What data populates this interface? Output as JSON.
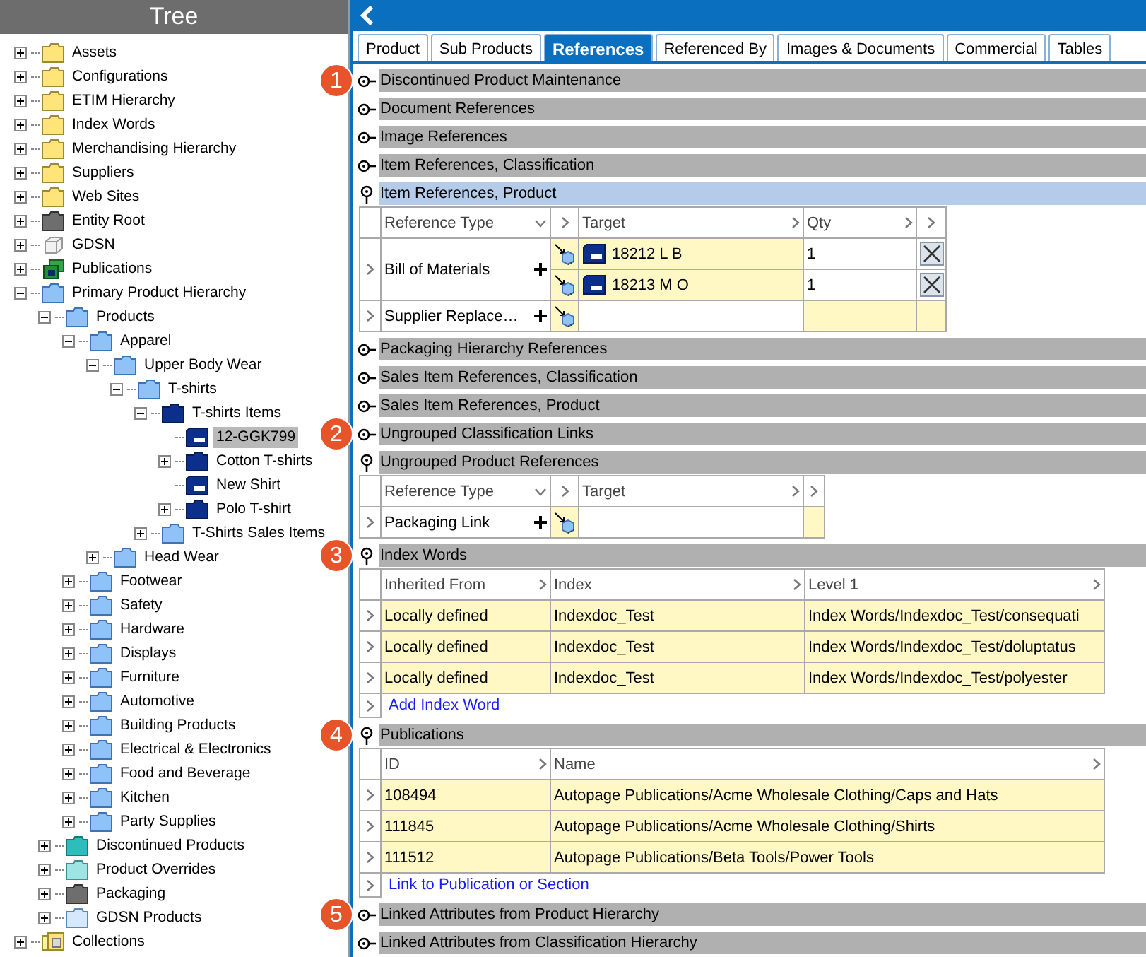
{
  "tree": {
    "title": "Tree",
    "items": [
      {
        "label": "Assets",
        "kind": "folder",
        "expanded": false,
        "selected": false
      },
      {
        "label": "Configurations",
        "kind": "folder",
        "expanded": false,
        "selected": false
      },
      {
        "label": "ETIM Hierarchy",
        "kind": "folder",
        "expanded": false,
        "selected": false
      },
      {
        "label": "Index Words",
        "kind": "folder",
        "expanded": false,
        "selected": false
      },
      {
        "label": "Merchandising Hierarchy",
        "kind": "folder",
        "expanded": false,
        "selected": false
      },
      {
        "label": "Suppliers",
        "kind": "folder",
        "expanded": false,
        "selected": false
      },
      {
        "label": "Web Sites",
        "kind": "folder",
        "expanded": false,
        "selected": false
      },
      {
        "label": "Entity Root",
        "kind": "entity-folder",
        "expanded": false,
        "selected": false
      },
      {
        "label": "GDSN",
        "kind": "cube",
        "expanded": false,
        "selected": false
      },
      {
        "label": "Publications",
        "kind": "publications",
        "expanded": false,
        "selected": false
      },
      {
        "label": "Primary Product Hierarchy",
        "kind": "category-folder",
        "expanded": true,
        "selected": false,
        "children": [
          {
            "label": "Products",
            "kind": "category-folder",
            "expanded": true,
            "selected": false,
            "children": [
              {
                "label": "Apparel",
                "kind": "category-folder",
                "expanded": true,
                "selected": false,
                "children": [
                  {
                    "label": "Upper Body Wear",
                    "kind": "category-folder",
                    "expanded": true,
                    "selected": false,
                    "children": [
                      {
                        "label": "T-shirts",
                        "kind": "category-folder",
                        "expanded": true,
                        "selected": false,
                        "children": [
                          {
                            "label": "T-shirts Items",
                            "kind": "product-folder",
                            "expanded": true,
                            "selected": false,
                            "children": [
                              {
                                "label": "12-GGK799",
                                "kind": "product",
                                "selected": true
                              },
                              {
                                "label": "Cotton T-shirts",
                                "kind": "product-folder",
                                "expanded": false,
                                "selected": false
                              },
                              {
                                "label": "New Shirt",
                                "kind": "product",
                                "selected": false
                              },
                              {
                                "label": "Polo T-shirt",
                                "kind": "product-folder",
                                "expanded": false,
                                "selected": false
                              }
                            ]
                          },
                          {
                            "label": "T-Shirts Sales Items",
                            "kind": "category-folder",
                            "expanded": false,
                            "selected": false
                          }
                        ]
                      }
                    ]
                  },
                  {
                    "label": "Head Wear",
                    "kind": "category-folder",
                    "expanded": false,
                    "selected": false
                  }
                ]
              },
              {
                "label": "Footwear",
                "kind": "category-folder",
                "expanded": false,
                "selected": false
              },
              {
                "label": "Safety",
                "kind": "category-folder",
                "expanded": false,
                "selected": false
              },
              {
                "label": "Hardware",
                "kind": "category-folder",
                "expanded": false,
                "selected": false
              },
              {
                "label": "Displays",
                "kind": "category-folder",
                "expanded": false,
                "selected": false
              },
              {
                "label": "Furniture",
                "kind": "category-folder",
                "expanded": false,
                "selected": false
              },
              {
                "label": "Automotive",
                "kind": "category-folder",
                "expanded": false,
                "selected": false
              },
              {
                "label": "Building Products",
                "kind": "category-folder",
                "expanded": false,
                "selected": false
              },
              {
                "label": "Electrical & Electronics",
                "kind": "category-folder",
                "expanded": false,
                "selected": false
              },
              {
                "label": "Food and Beverage",
                "kind": "category-folder",
                "expanded": false,
                "selected": false
              },
              {
                "label": "Kitchen",
                "kind": "category-folder",
                "expanded": false,
                "selected": false
              },
              {
                "label": "Party Supplies",
                "kind": "category-folder",
                "expanded": false,
                "selected": false
              }
            ]
          },
          {
            "label": "Discontinued Products",
            "kind": "discontinued-folder",
            "expanded": false,
            "selected": false
          },
          {
            "label": "Product Overrides",
            "kind": "override-folder",
            "expanded": false,
            "selected": false
          },
          {
            "label": "Packaging",
            "kind": "entity-folder",
            "expanded": false,
            "selected": false
          },
          {
            "label": "GDSN Products",
            "kind": "gdsn-folder",
            "expanded": false,
            "selected": false
          }
        ]
      },
      {
        "label": "Collections",
        "kind": "collections",
        "expanded": false,
        "selected": false
      }
    ]
  },
  "tabs": [
    {
      "label": "Product",
      "selected": false
    },
    {
      "label": "Sub Products",
      "selected": false
    },
    {
      "label": "References",
      "selected": true
    },
    {
      "label": "Referenced By",
      "selected": false
    },
    {
      "label": "Images & Documents",
      "selected": false
    },
    {
      "label": "Commercial",
      "selected": false
    },
    {
      "label": "Tables",
      "selected": false
    }
  ],
  "sections": [
    {
      "title": "Discontinued Product Maintenance",
      "expanded": false,
      "selected": false,
      "callout": "1"
    },
    {
      "title": "Document References",
      "expanded": false,
      "selected": false
    },
    {
      "title": "Image References",
      "expanded": false,
      "selected": false
    },
    {
      "title": "Item References, Classification",
      "expanded": false,
      "selected": false
    },
    {
      "title": "Item References, Product",
      "expanded": true,
      "selected": true,
      "table": {
        "kind": "references",
        "columns": [
          "Reference Type",
          "Target",
          "Qty"
        ],
        "groups": [
          {
            "type": "Bill of Materials",
            "targets": [
              {
                "name": "18212 L B",
                "qty": "1"
              },
              {
                "name": "18213 M O",
                "qty": "1"
              }
            ]
          },
          {
            "type": "Supplier Replace…"
          }
        ]
      }
    },
    {
      "title": "Packaging Hierarchy References",
      "expanded": false,
      "selected": false
    },
    {
      "title": "Sales Item References, Classification",
      "expanded": false,
      "selected": false
    },
    {
      "title": "Sales Item References, Product",
      "expanded": false,
      "selected": false
    },
    {
      "title": "Ungrouped Classification Links",
      "expanded": false,
      "selected": false,
      "callout": "2"
    },
    {
      "title": "Ungrouped Product References",
      "expanded": true,
      "selected": false,
      "table": {
        "kind": "references",
        "columns": [
          "Reference Type",
          "Target"
        ],
        "groups": [
          {
            "type": "Packaging Link"
          }
        ]
      }
    },
    {
      "title": "Index Words",
      "expanded": true,
      "selected": false,
      "callout": "3",
      "table": {
        "kind": "grid",
        "columns": [
          "Inherited From",
          "Index",
          "Level 1"
        ],
        "rows": [
          [
            "Locally defined",
            "Indexdoc_Test",
            "Index Words/Indexdoc_Test/consequati"
          ],
          [
            "Locally defined",
            "Indexdoc_Test",
            "Index Words/Indexdoc_Test/doluptatus"
          ],
          [
            "Locally defined",
            "Indexdoc_Test",
            "Index Words/Indexdoc_Test/polyester"
          ]
        ],
        "add_link": "Add Index Word"
      }
    },
    {
      "title": "Publications",
      "expanded": true,
      "selected": false,
      "callout": "4",
      "table": {
        "kind": "grid",
        "columns": [
          "ID",
          "Name"
        ],
        "rows": [
          [
            "108494",
            "Autopage Publications/Acme Wholesale Clothing/Caps and Hats"
          ],
          [
            "111845",
            "Autopage Publications/Acme Wholesale Clothing/Shirts"
          ],
          [
            "111512",
            "Autopage Publications/Beta Tools/Power Tools"
          ]
        ],
        "add_link": "Link to Publication or Section"
      }
    },
    {
      "title": "Linked Attributes from Product Hierarchy",
      "expanded": false,
      "selected": false,
      "callout": "5"
    },
    {
      "title": "Linked Attributes from Classification Hierarchy",
      "expanded": false,
      "selected": false
    }
  ]
}
